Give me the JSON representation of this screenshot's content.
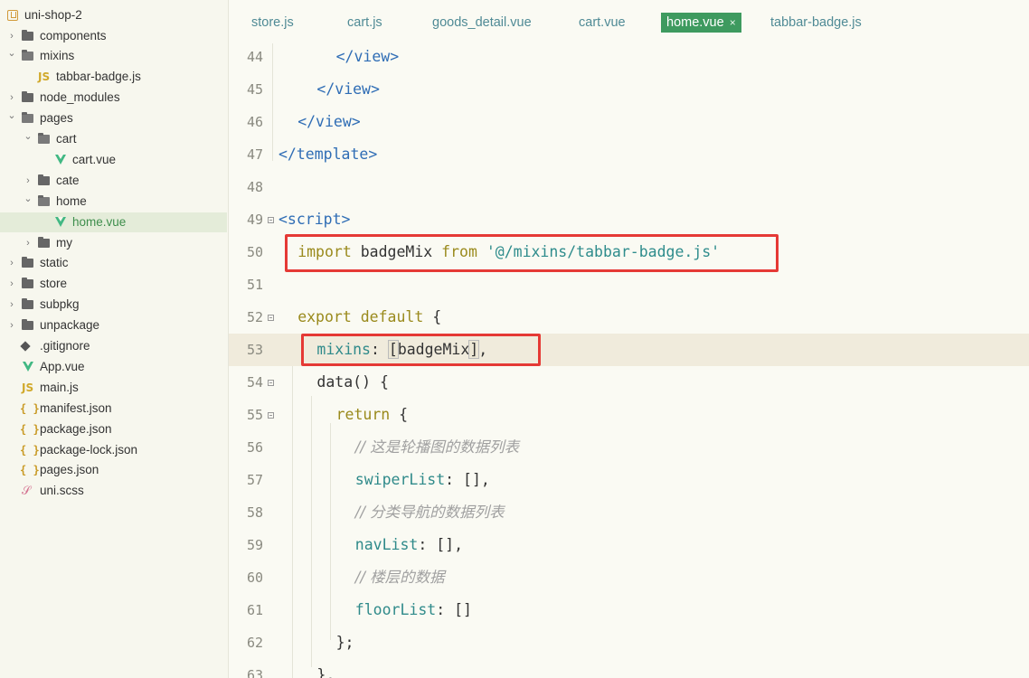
{
  "sidebar": {
    "project": "uni-shop-2",
    "items": [
      {
        "label": "components",
        "kind": "folder",
        "depth": 1,
        "expanded": false
      },
      {
        "label": "mixins",
        "kind": "folder",
        "depth": 1,
        "expanded": true
      },
      {
        "label": "tabbar-badge.js",
        "kind": "js",
        "depth": 2
      },
      {
        "label": "node_modules",
        "kind": "folder",
        "depth": 1,
        "expanded": false
      },
      {
        "label": "pages",
        "kind": "folder",
        "depth": 1,
        "expanded": true
      },
      {
        "label": "cart",
        "kind": "folder",
        "depth": 2,
        "expanded": true
      },
      {
        "label": "cart.vue",
        "kind": "vue",
        "depth": 3
      },
      {
        "label": "cate",
        "kind": "folder",
        "depth": 2,
        "expanded": false
      },
      {
        "label": "home",
        "kind": "folder",
        "depth": 2,
        "expanded": true
      },
      {
        "label": "home.vue",
        "kind": "vue",
        "depth": 3,
        "selected": true
      },
      {
        "label": "my",
        "kind": "folder",
        "depth": 2,
        "expanded": false
      },
      {
        "label": "static",
        "kind": "folder",
        "depth": 1,
        "expanded": false
      },
      {
        "label": "store",
        "kind": "folder",
        "depth": 1,
        "expanded": false
      },
      {
        "label": "subpkg",
        "kind": "folder",
        "depth": 1,
        "expanded": false
      },
      {
        "label": "unpackage",
        "kind": "folder",
        "depth": 1,
        "expanded": false
      },
      {
        "label": ".gitignore",
        "kind": "git",
        "depth": 1
      },
      {
        "label": "App.vue",
        "kind": "vue",
        "depth": 1
      },
      {
        "label": "main.js",
        "kind": "js",
        "depth": 1
      },
      {
        "label": "manifest.json",
        "kind": "json",
        "depth": 1
      },
      {
        "label": "package.json",
        "kind": "json",
        "depth": 1
      },
      {
        "label": "package-lock.json",
        "kind": "json",
        "depth": 1
      },
      {
        "label": "pages.json",
        "kind": "json",
        "depth": 1
      },
      {
        "label": "uni.scss",
        "kind": "scss",
        "depth": 1
      }
    ]
  },
  "tabs": [
    {
      "label": "store.js",
      "active": false
    },
    {
      "label": "cart.js",
      "active": false
    },
    {
      "label": "goods_detail.vue",
      "active": false
    },
    {
      "label": "cart.vue",
      "active": false
    },
    {
      "label": "home.vue",
      "active": true,
      "close": "×"
    },
    {
      "label": "tabbar-badge.js",
      "active": false
    }
  ],
  "editor": {
    "current_line": 53,
    "lines": [
      {
        "n": "44",
        "indent": 3,
        "tokens": [
          [
            "tag",
            "</view>"
          ]
        ]
      },
      {
        "n": "45",
        "indent": 2,
        "tokens": [
          [
            "tag",
            "</view>"
          ]
        ]
      },
      {
        "n": "46",
        "indent": 1,
        "tokens": [
          [
            "tag",
            "</view>"
          ]
        ]
      },
      {
        "n": "47",
        "indent": 0,
        "tokens": [
          [
            "tag",
            "</template>"
          ]
        ]
      },
      {
        "n": "48",
        "indent": 0,
        "tokens": []
      },
      {
        "n": "49",
        "indent": 0,
        "fold": true,
        "tokens": [
          [
            "tag",
            "<script>"
          ]
        ]
      },
      {
        "n": "50",
        "indent": 1,
        "tokens": [
          [
            "kw",
            "import"
          ],
          [
            "id",
            " badgeMix "
          ],
          [
            "kw",
            "from"
          ],
          [
            "id",
            " "
          ],
          [
            "str",
            "'@/mixins/tabbar-badge.js'"
          ]
        ]
      },
      {
        "n": "51",
        "indent": 0,
        "tokens": []
      },
      {
        "n": "52",
        "indent": 1,
        "fold": true,
        "tokens": [
          [
            "kw",
            "export default"
          ],
          [
            "punc",
            " {"
          ]
        ]
      },
      {
        "n": "53",
        "indent": 2,
        "tokens": [
          [
            "prop",
            "mixins"
          ],
          [
            "punc",
            ": "
          ],
          [
            "bracket",
            "["
          ],
          [
            "id",
            "badgeMix"
          ],
          [
            "bracket",
            "]"
          ],
          [
            "punc",
            ","
          ]
        ]
      },
      {
        "n": "54",
        "indent": 2,
        "fold": true,
        "tokens": [
          [
            "id",
            "data"
          ],
          [
            "punc",
            "() {"
          ]
        ]
      },
      {
        "n": "55",
        "indent": 3,
        "fold": true,
        "tokens": [
          [
            "kw",
            "return"
          ],
          [
            "punc",
            " {"
          ]
        ]
      },
      {
        "n": "56",
        "indent": 4,
        "tokens": [
          [
            "comment",
            "// 这是轮播图的数据列表"
          ]
        ]
      },
      {
        "n": "57",
        "indent": 4,
        "tokens": [
          [
            "prop",
            "swiperList"
          ],
          [
            "punc",
            ": [],"
          ]
        ]
      },
      {
        "n": "58",
        "indent": 4,
        "tokens": [
          [
            "comment",
            "// 分类导航的数据列表"
          ]
        ]
      },
      {
        "n": "59",
        "indent": 4,
        "tokens": [
          [
            "prop",
            "navList"
          ],
          [
            "punc",
            ": [],"
          ]
        ]
      },
      {
        "n": "60",
        "indent": 4,
        "tokens": [
          [
            "comment",
            "// 楼层的数据"
          ]
        ]
      },
      {
        "n": "61",
        "indent": 4,
        "tokens": [
          [
            "prop",
            "floorList"
          ],
          [
            "punc",
            ": []"
          ]
        ]
      },
      {
        "n": "62",
        "indent": 3,
        "tokens": [
          [
            "punc",
            "};"
          ]
        ]
      },
      {
        "n": "63",
        "indent": 2,
        "tokens": [
          [
            "punc",
            "},"
          ]
        ]
      }
    ]
  },
  "annotations": [
    {
      "label": "import-highlight-box",
      "line": "50"
    },
    {
      "label": "mixins-highlight-box",
      "line": "53"
    }
  ],
  "colors": {
    "accent_tab": "#3e9a5f",
    "highlight_box": "#e53935",
    "tag": "#2f6db5",
    "keyword": "#9a8a1c",
    "string": "#2e8c8c"
  }
}
